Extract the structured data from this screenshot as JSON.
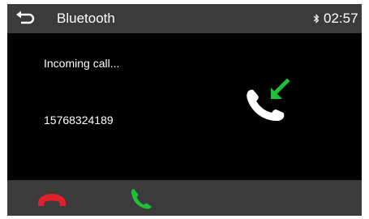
{
  "header": {
    "back_icon": "back-arrow-icon",
    "title": "Bluetooth",
    "bluetooth_icon": "bluetooth-icon",
    "time": "02:57"
  },
  "call": {
    "status": "Incoming call...",
    "number": "15768324189",
    "icon": "incoming-call-icon"
  },
  "actions": {
    "reject_icon": "hang-up-icon",
    "answer_icon": "answer-call-icon"
  },
  "colors": {
    "bar_bg": "#3b3b3b",
    "screen_bg": "#000000",
    "reject": "#e0202a",
    "answer": "#1fbf3a"
  }
}
